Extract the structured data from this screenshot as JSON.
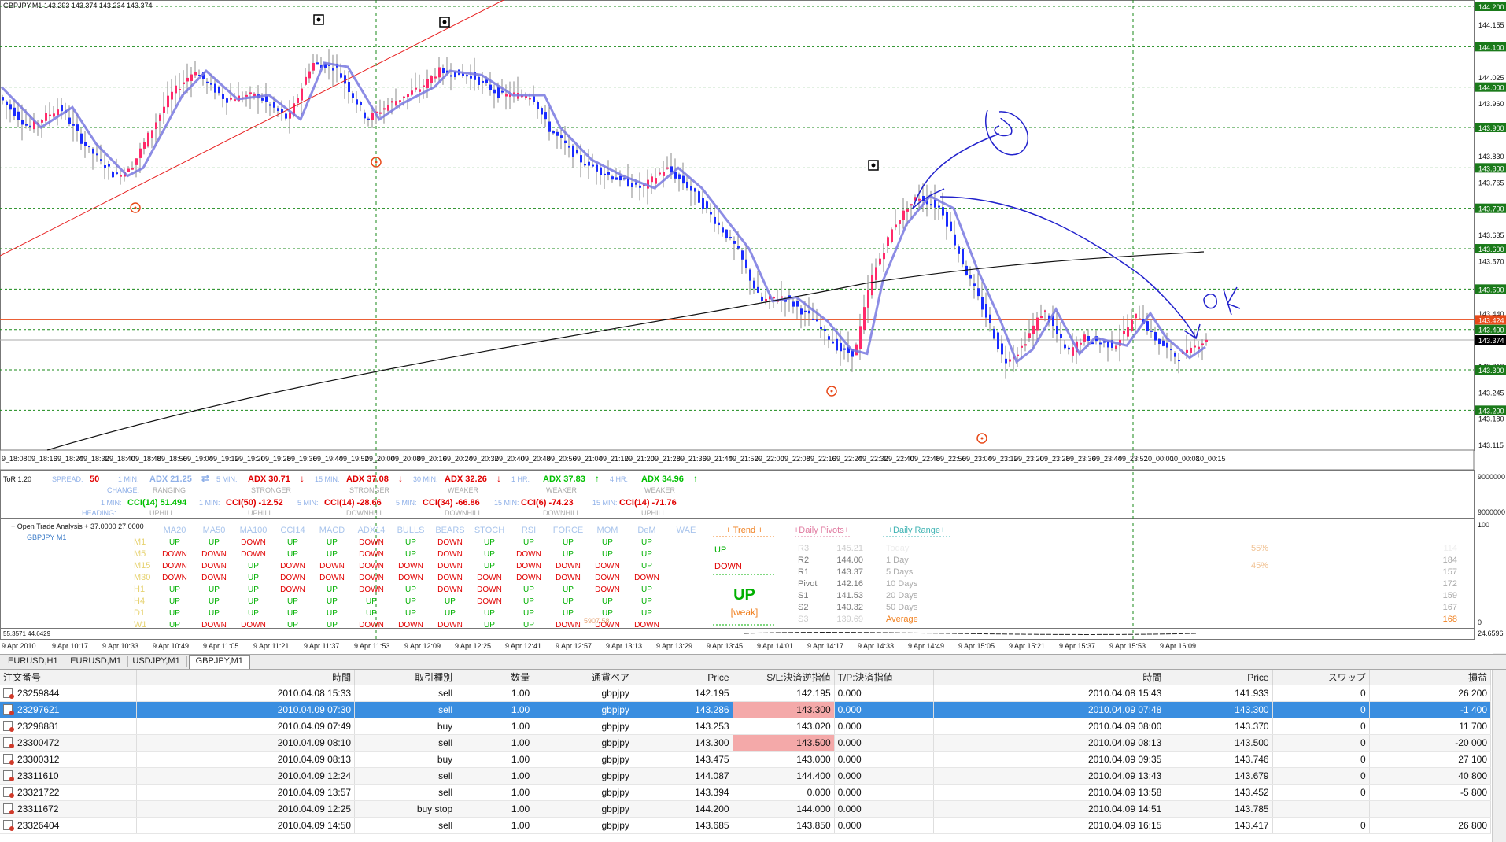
{
  "chart_title": "GBPJPY,M1  143.293 143.374 143.234 143.374",
  "price_axis": {
    "labels": [
      "144.200",
      "144.155",
      "144.100",
      "144.025",
      "144.000",
      "143.960",
      "143.900",
      "143.830",
      "143.800",
      "143.765",
      "143.700",
      "143.635",
      "143.600",
      "143.570",
      "143.500",
      "143.440",
      "143.424",
      "143.400",
      "143.374",
      "143.310",
      "143.300",
      "143.245",
      "143.200",
      "143.180",
      "143.115"
    ],
    "highlight": {
      "143.424": "#e84a1a",
      "143.374": "#000000"
    }
  },
  "time_labels_main": [
    "9_18:08",
    "09_18:16",
    "09_18:24",
    "09_18:32",
    "09_18:40",
    "09_18:48",
    "09_18:56",
    "09_19:04",
    "09_19:12",
    "09_19:20",
    "09_19:28",
    "09_19:36",
    "09_19:44",
    "09_19:52",
    "09_20:00",
    "09_20:08",
    "09_20:16",
    "09_20:24",
    "09_20:32",
    "09_20:40",
    "09_20:48",
    "09_20:56",
    "09_21:04",
    "09_21:12",
    "09_21:20",
    "09_21:28",
    "09_21:36",
    "09_21:44",
    "09_21:52",
    "09_22:00",
    "09_22:08",
    "09_22:16",
    "09_22:24",
    "09_22:32",
    "09_22:40",
    "09_22:48",
    "09_22:56",
    "09_23:04",
    "09_23:12",
    "09_23:20",
    "09_23:28",
    "09_23:36",
    "09_23:44",
    "09_23:52",
    "10_00:00",
    "10_00:08",
    "10_00:15"
  ],
  "tor": {
    "title": "ToR 1.20",
    "spread_label": "SPREAD:",
    "spread_value": "50",
    "change_label": "CHANGE:",
    "heading_label": "HEADING:",
    "row1": [
      {
        "tf": "1 MIN:",
        "val": "ADX 21.25",
        "arrow": "⇄",
        "col": "#8fb0e8",
        "sub": "RANGING"
      },
      {
        "tf": "5 MIN:",
        "val": "ADX 30.71",
        "arrow": "↓",
        "col": "#e00000",
        "sub": "STRONGER"
      },
      {
        "tf": "15 MIN:",
        "val": "ADX 37.08",
        "arrow": "↓",
        "col": "#e00000",
        "sub": "STRONGER"
      },
      {
        "tf": "30 MIN:",
        "val": "ADX 32.26",
        "arrow": "↓",
        "col": "#e00000",
        "sub": "WEAKER"
      },
      {
        "tf": "1 HR:",
        "val": "ADX 37.83",
        "arrow": "↑",
        "col": "#00c000",
        "sub": "WEAKER"
      },
      {
        "tf": "4 HR:",
        "val": "ADX 34.96",
        "arrow": "↑",
        "col": "#00c000",
        "sub": "WEAKER"
      }
    ],
    "row2": [
      {
        "tf": "1 MIN:",
        "val": "CCI(14) 51.494",
        "col": "#00c000",
        "sub": "UPHILL"
      },
      {
        "tf": "1 MIN:",
        "val": "CCI(50) -12.52",
        "col": "#e00000",
        "sub": "UPHILL"
      },
      {
        "tf": "5 MIN:",
        "val": "CCI(14) -28.66",
        "col": "#e00000",
        "sub": "DOWNHILL"
      },
      {
        "tf": "5 MIN:",
        "val": "CCI(34) -66.86",
        "col": "#e00000",
        "sub": "DOWNHILL"
      },
      {
        "tf": "15 MIN:",
        "val": "CCI(6) -74.23",
        "col": "#e00000",
        "sub": "DOWNHILL"
      },
      {
        "tf": "15 MIN:",
        "val": "CCI(14) -71.76",
        "col": "#e00000",
        "sub": "UPHILL"
      }
    ],
    "axis_top": "9000000",
    "axis_bottom": "9000000"
  },
  "ota": {
    "title": "+ Open Trade Analysis + 37.0000 27.0000",
    "symbol": "GBPJPY  M1",
    "headers": [
      "MA20",
      "MA50",
      "MA100",
      "CCI14",
      "MACD",
      "ADX14",
      "BULLS",
      "BEARS",
      "STOCH",
      "RSI",
      "FORCE",
      "MOM",
      "DeM",
      "WAE"
    ],
    "timeframes": [
      "M1",
      "M5",
      "M15",
      "M30",
      "H1",
      "H4",
      "D1",
      "W1"
    ],
    "rows": [
      [
        "UP",
        "UP",
        "DOWN",
        "UP",
        "UP",
        "DOWN",
        "UP",
        "DOWN",
        "UP",
        "UP",
        "UP",
        "UP",
        "UP"
      ],
      [
        "DOWN",
        "DOWN",
        "DOWN",
        "UP",
        "UP",
        "DOWN",
        "UP",
        "DOWN",
        "UP",
        "DOWN",
        "UP",
        "UP",
        "UP"
      ],
      [
        "DOWN",
        "DOWN",
        "UP",
        "DOWN",
        "DOWN",
        "DOWN",
        "DOWN",
        "DOWN",
        "UP",
        "DOWN",
        "DOWN",
        "DOWN",
        "UP"
      ],
      [
        "DOWN",
        "DOWN",
        "UP",
        "DOWN",
        "DOWN",
        "DOWN",
        "DOWN",
        "DOWN",
        "DOWN",
        "DOWN",
        "DOWN",
        "DOWN",
        "DOWN"
      ],
      [
        "UP",
        "UP",
        "UP",
        "DOWN",
        "UP",
        "DOWN",
        "UP",
        "DOWN",
        "DOWN",
        "UP",
        "UP",
        "DOWN",
        "UP"
      ],
      [
        "UP",
        "UP",
        "UP",
        "UP",
        "UP",
        "UP",
        "UP",
        "UP",
        "DOWN",
        "UP",
        "UP",
        "UP",
        "UP"
      ],
      [
        "UP",
        "UP",
        "UP",
        "UP",
        "UP",
        "UP",
        "UP",
        "UP",
        "UP",
        "UP",
        "UP",
        "UP",
        "UP"
      ],
      [
        "UP",
        "DOWN",
        "DOWN",
        "UP",
        "UP",
        "DOWN",
        "DOWN",
        "DOWN",
        "UP",
        "UP",
        "DOWN",
        "DOWN",
        "DOWN"
      ]
    ],
    "force_extra": "5907.58",
    "trend": {
      "header": "+   Trend   +",
      "up": "UP",
      "down": "DOWN",
      "big": "UP",
      "weak": "[weak]"
    },
    "pivots": {
      "header": "+Daily Pivots+",
      "labels": [
        "R3",
        "R2",
        "R1",
        "Pivot",
        "S1",
        "S2",
        "S3"
      ],
      "values": [
        "145.21",
        "144.00",
        "143.37",
        "142.16",
        "141.53",
        "140.32",
        "139.69"
      ]
    },
    "range": {
      "header": "+Daily Range+",
      "labels": [
        "Today",
        "1 Day",
        "5 Days",
        "10 Days",
        "20 Days",
        "50 Days",
        "Average"
      ],
      "values": [
        "114",
        "184",
        "157",
        "172",
        "159",
        "167",
        "168"
      ],
      "pct1": "55%",
      "pct2": "45%"
    },
    "axis_right_top": "100",
    "axis_right_bottom": "0"
  },
  "bottom_axis": {
    "left_label": "55.3571 44.6429",
    "right_label": "24.6596",
    "times": [
      "9 Apr 2010",
      "9 Apr 10:17",
      "9 Apr 10:33",
      "9 Apr 10:49",
      "9 Apr 11:05",
      "9 Apr 11:21",
      "9 Apr 11:37",
      "9 Apr 11:53",
      "9 Apr 12:09",
      "9 Apr 12:25",
      "9 Apr 12:41",
      "9 Apr 12:57",
      "9 Apr 13:13",
      "9 Apr 13:29",
      "9 Apr 13:45",
      "9 Apr 14:01",
      "9 Apr 14:17",
      "9 Apr 14:33",
      "9 Apr 14:49",
      "9 Apr 15:05",
      "9 Apr 15:21",
      "9 Apr 15:37",
      "9 Apr 15:53",
      "9 Apr 16:09"
    ]
  },
  "tabs": [
    "EURUSD,H1",
    "EURUSD,M1",
    "USDJPY,M1",
    "GBPJPY,M1"
  ],
  "active_tab": 3,
  "table": {
    "headers": [
      "注文番号",
      "時間",
      "取引種別",
      "数量",
      "通貨ペア",
      "Price",
      "S/L:決済逆指値",
      "T/P:決済指値",
      "時間",
      "Price",
      "スワップ",
      "損益"
    ],
    "rows": [
      [
        "23259844",
        "2010.04.08 15:33",
        "sell",
        "1.00",
        "gbpjpy",
        "142.195",
        "142.195",
        "0.000",
        "2010.04.08 15:43",
        "141.933",
        "0",
        "26 200"
      ],
      [
        "23297621",
        "2010.04.09 07:30",
        "sell",
        "1.00",
        "gbpjpy",
        "143.286",
        "143.300",
        "0.000",
        "2010.04.09 07:48",
        "143.300",
        "0",
        "-1 400"
      ],
      [
        "23298881",
        "2010.04.09 07:49",
        "buy",
        "1.00",
        "gbpjpy",
        "143.253",
        "143.020",
        "0.000",
        "2010.04.09 08:00",
        "143.370",
        "0",
        "11 700"
      ],
      [
        "23300472",
        "2010.04.09 08:10",
        "sell",
        "1.00",
        "gbpjpy",
        "143.300",
        "143.500",
        "0.000",
        "2010.04.09 08:13",
        "143.500",
        "0",
        "-20 000"
      ],
      [
        "23300312",
        "2010.04.09 08:13",
        "buy",
        "1.00",
        "gbpjpy",
        "143.475",
        "143.000",
        "0.000",
        "2010.04.09 09:35",
        "143.746",
        "0",
        "27 100"
      ],
      [
        "23311610",
        "2010.04.09 12:24",
        "sell",
        "1.00",
        "gbpjpy",
        "144.087",
        "144.400",
        "0.000",
        "2010.04.09 13:43",
        "143.679",
        "0",
        "40 800"
      ],
      [
        "23321722",
        "2010.04.09 13:57",
        "sell",
        "1.00",
        "gbpjpy",
        "143.394",
        "0.000",
        "0.000",
        "2010.04.09 13:58",
        "143.452",
        "0",
        "-5 800"
      ],
      [
        "23311672",
        "2010.04.09 12:25",
        "buy stop",
        "1.00",
        "gbpjpy",
        "144.200",
        "144.000",
        "0.000",
        "2010.04.09 14:51",
        "143.785",
        "",
        ""
      ],
      [
        "23326404",
        "2010.04.09 14:50",
        "sell",
        "1.00",
        "gbpjpy",
        "143.685",
        "143.850",
        "0.000",
        "2010.04.09 16:15",
        "143.417",
        "0",
        "26 800"
      ]
    ],
    "selected_row": 1,
    "highlight_cells": [
      [
        1,
        6
      ],
      [
        3,
        6
      ]
    ]
  },
  "colors": {
    "up_candle": "#ff2a6a",
    "down_candle": "#1a2cff",
    "ma": "#7878e0",
    "grid": "#1a8a1a",
    "annot": "#2222cc",
    "sel": "#3a8ee0"
  }
}
